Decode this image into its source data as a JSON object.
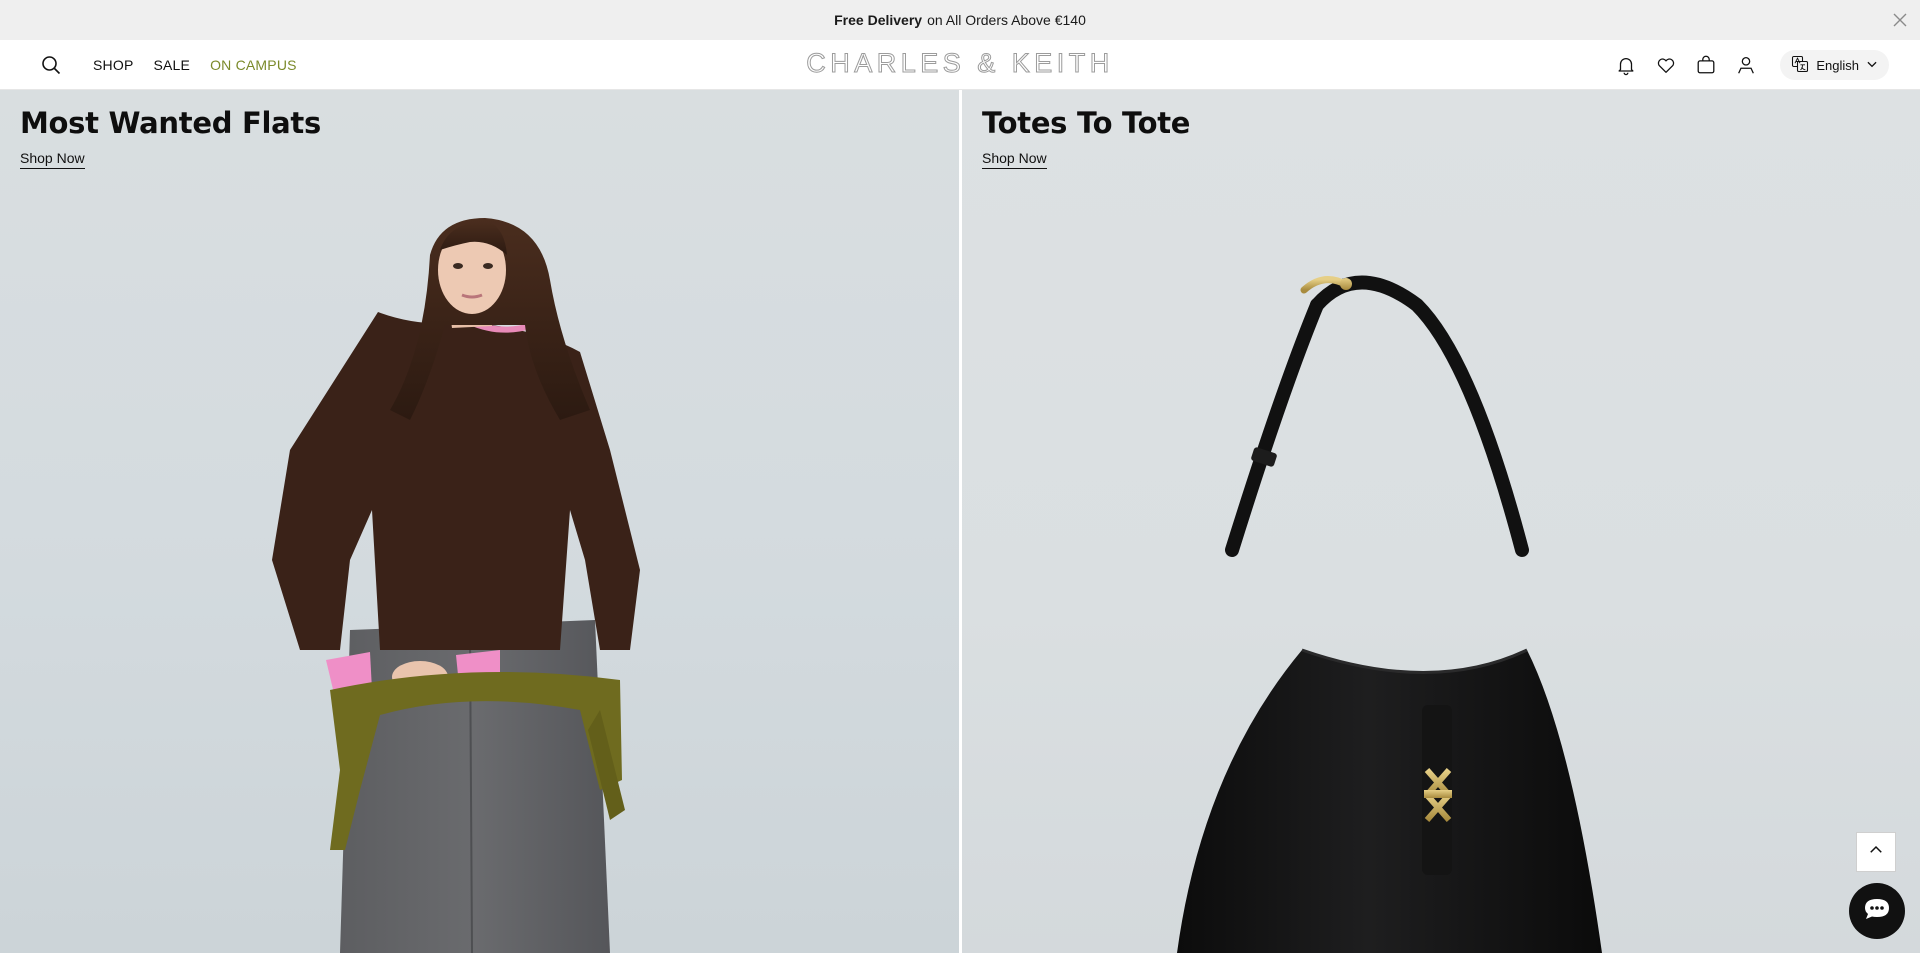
{
  "announcement": {
    "bold": "Free Delivery",
    "text": "on All Orders Above €140",
    "close_icon": "close-icon"
  },
  "header": {
    "logo": "CHARLES & KEITH",
    "nav": [
      {
        "label": "SHOP"
      },
      {
        "label": "SALE"
      },
      {
        "label": "ON CAMPUS",
        "color": "#7b8a2a"
      }
    ],
    "icons": [
      "search-icon",
      "bell-icon",
      "heart-icon",
      "shopping-bag-icon",
      "user-icon",
      "translate-icon"
    ],
    "language": "English"
  },
  "hero": {
    "left": {
      "title": "Most Wanted Flats",
      "cta": "Shop Now"
    },
    "right": {
      "title": "Totes To Tote",
      "cta": "Shop Now"
    }
  },
  "floating": {
    "scroll_top_icon": "chevron-up-icon",
    "chat_icon": "chat-icon"
  },
  "colors": {
    "accent_campus": "#7b8a2a",
    "announcement_bg": "#efefef"
  }
}
